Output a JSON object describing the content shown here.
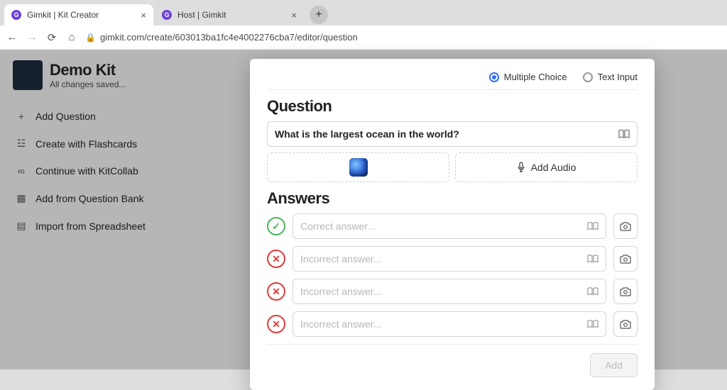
{
  "browser": {
    "tabs": [
      {
        "title": "Gimkit | Kit Creator",
        "active": true
      },
      {
        "title": "Host | Gimkit",
        "active": false
      }
    ],
    "url": "gimkit.com/create/603013ba1fc4e4002276cba7/editor/question"
  },
  "sidebar": {
    "kit_title": "Demo Kit",
    "save_status": "All changes saved...",
    "items": [
      {
        "icon": "+",
        "label": "Add Question"
      },
      {
        "icon": "bell",
        "label": "Create with Flashcards"
      },
      {
        "icon": "link",
        "label": "Continue with KitCollab"
      },
      {
        "icon": "bank",
        "label": "Add from Question Bank"
      },
      {
        "icon": "grid",
        "label": "Import from Spreadsheet"
      }
    ]
  },
  "editor": {
    "type_options": {
      "multiple_choice": "Multiple Choice",
      "text_input": "Text Input",
      "selected": "multiple_choice"
    },
    "question_heading": "Question",
    "question_text": "What is the largest ocean in the world?",
    "add_audio_label": "Add Audio",
    "answers_heading": "Answers",
    "answers": [
      {
        "correct": true,
        "placeholder": "Correct answer..."
      },
      {
        "correct": false,
        "placeholder": "Incorrect answer..."
      },
      {
        "correct": false,
        "placeholder": "Incorrect answer..."
      },
      {
        "correct": false,
        "placeholder": "Incorrect answer..."
      }
    ],
    "add_button": "Add"
  }
}
